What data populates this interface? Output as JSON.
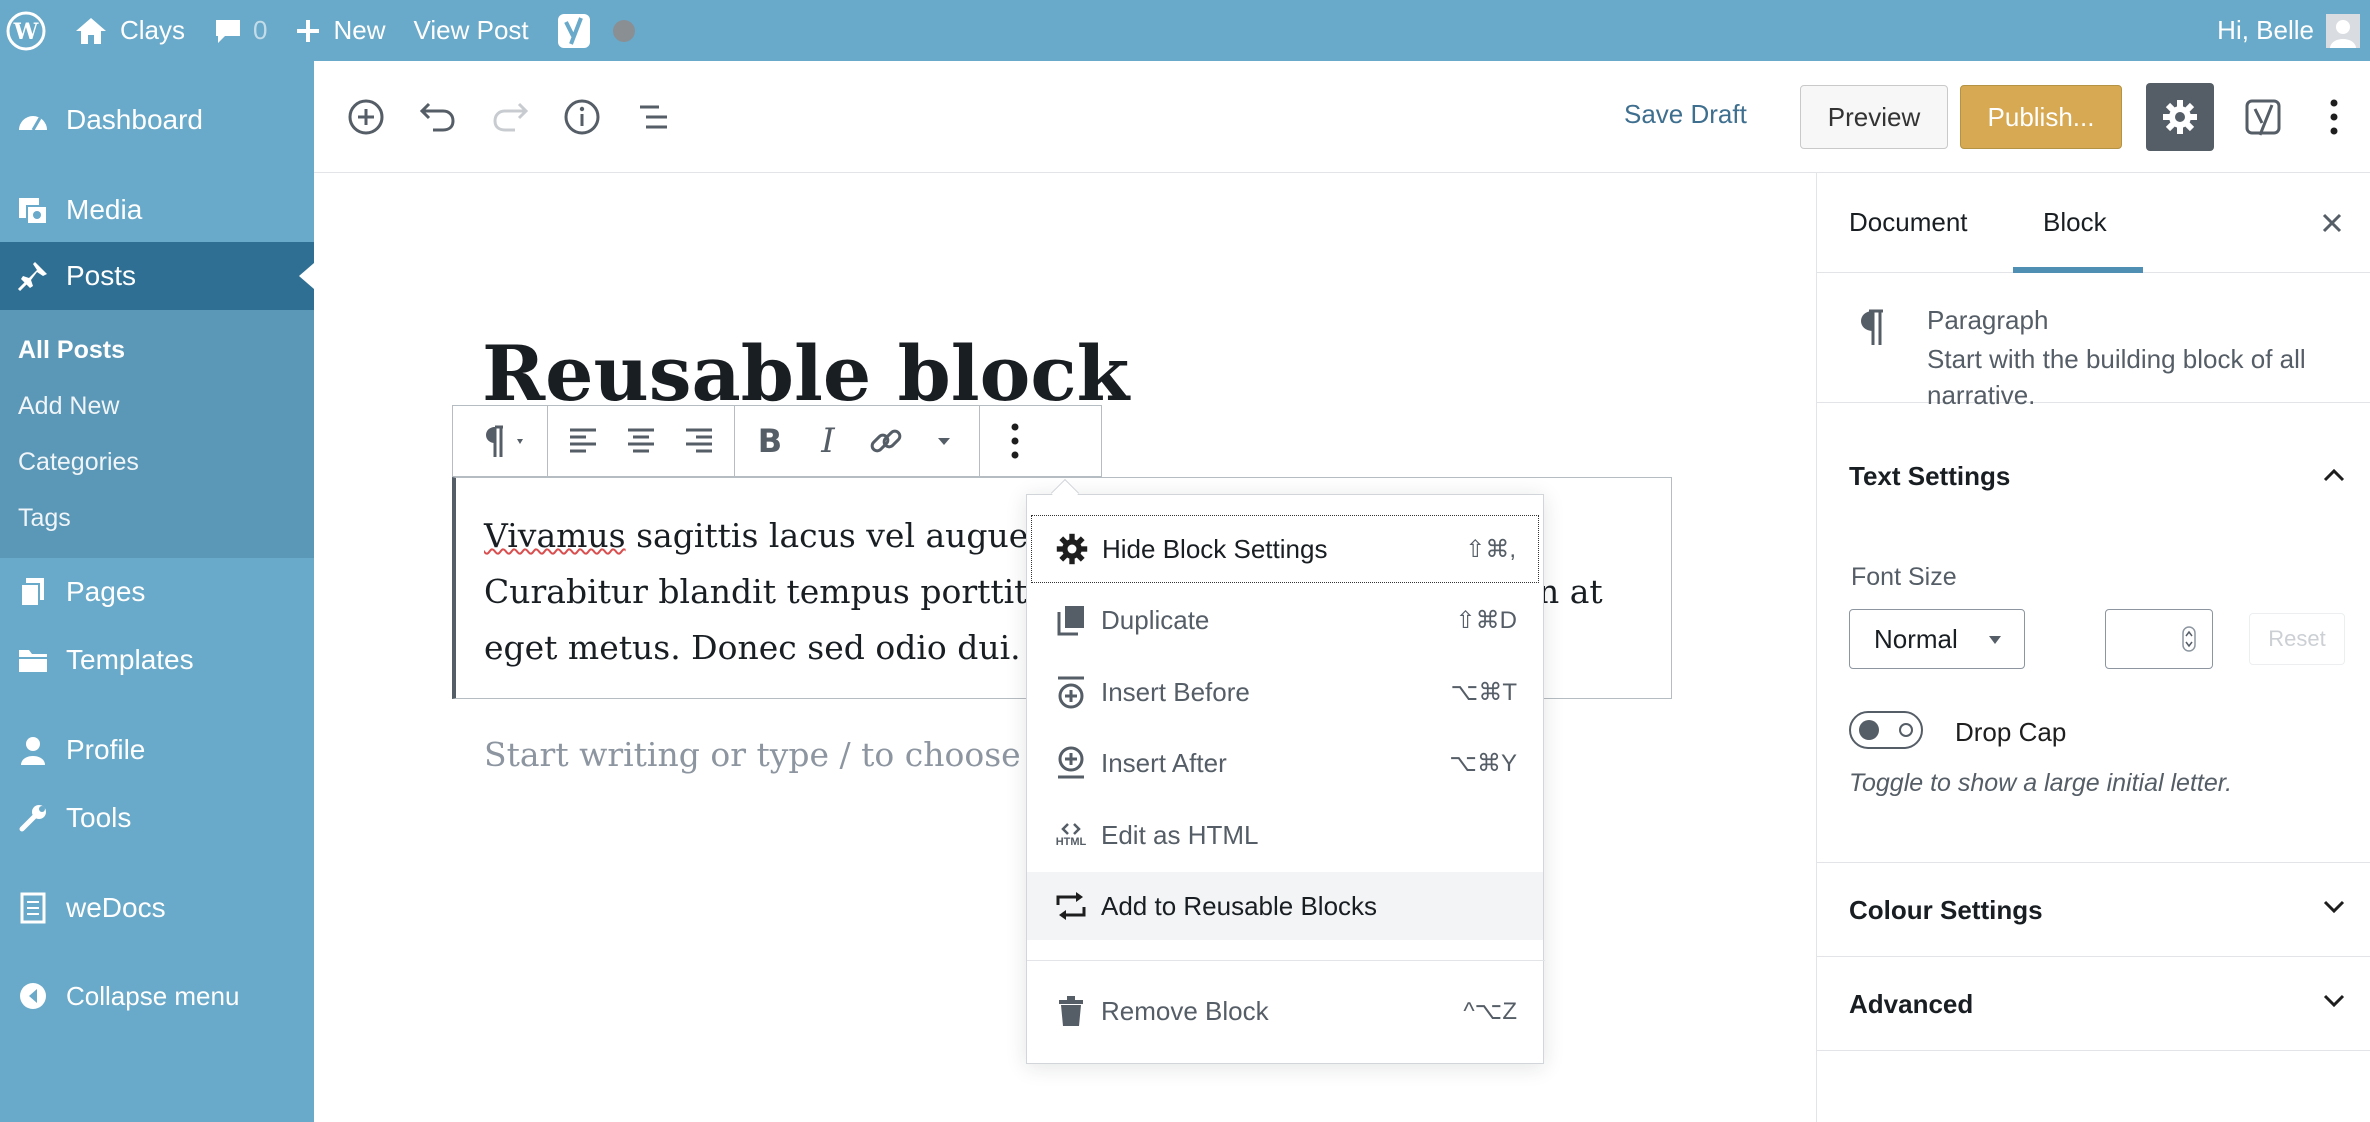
{
  "admin_bar": {
    "site_name": "Clays",
    "comments_count": "0",
    "new_label": "New",
    "view_post_label": "View Post",
    "greeting": "Hi, Belle"
  },
  "sidebar": {
    "items": [
      {
        "label": "Dashboard",
        "icon": "dashboard-icon"
      },
      {
        "label": "Media",
        "icon": "media-icon"
      },
      {
        "label": "Posts",
        "icon": "pin-icon"
      },
      {
        "label": "Pages",
        "icon": "pages-icon"
      },
      {
        "label": "Templates",
        "icon": "folder-icon"
      },
      {
        "label": "Profile",
        "icon": "user-icon"
      },
      {
        "label": "Tools",
        "icon": "wrench-icon"
      },
      {
        "label": "weDocs",
        "icon": "document-icon"
      }
    ],
    "submenu": [
      "All Posts",
      "Add New",
      "Categories",
      "Tags"
    ],
    "collapse_label": "Collapse menu"
  },
  "toolbar": {
    "save_draft": "Save Draft",
    "preview": "Preview",
    "publish": "Publish..."
  },
  "editor": {
    "title": "Reusable block",
    "paragraph_lines": [
      {
        "spell": "Vivamus",
        "rest": " sagittis lacus vel augue lao",
        "tail": "."
      },
      {
        "text": "Curabitur blandit tempus porttitor.",
        "tail": "n at"
      },
      {
        "text": "eget metus. Donec sed odio dui."
      }
    ],
    "placeholder": "Start writing or type / to choose a bl"
  },
  "block_menu": {
    "items": [
      {
        "label": "Hide Block Settings",
        "shortcut": "⇧⌘,",
        "icon": "gear-icon"
      },
      {
        "label": "Duplicate",
        "shortcut": "⇧⌘D",
        "icon": "duplicate-icon"
      },
      {
        "label": "Insert Before",
        "shortcut": "⌥⌘T",
        "icon": "insert-before-icon"
      },
      {
        "label": "Insert After",
        "shortcut": "⌥⌘Y",
        "icon": "insert-after-icon"
      },
      {
        "label": "Edit as HTML",
        "shortcut": "",
        "icon": "html-icon"
      },
      {
        "label": "Add to Reusable Blocks",
        "shortcut": "",
        "icon": "reusable-icon"
      },
      {
        "label": "Remove Block",
        "shortcut": "^⌥Z",
        "icon": "trash-icon"
      }
    ],
    "html_icon_text": "HTML"
  },
  "settings_panel": {
    "tabs": [
      "Document",
      "Block"
    ],
    "active_tab": "Block",
    "block_card": {
      "title": "Paragraph",
      "description_line1": "Start with the building block of all",
      "description_line2": "narrative."
    },
    "text_settings": {
      "title": "Text Settings",
      "font_size_label": "Font Size",
      "font_size_value": "Normal",
      "reset_label": "Reset",
      "drop_cap_label": "Drop Cap",
      "drop_cap_help": "Toggle to show a large initial letter.",
      "drop_cap_enabled": false
    },
    "colour_settings_title": "Colour Settings",
    "advanced_title": "Advanced"
  },
  "colors": {
    "admin_blue": "#69a9c9",
    "current_menu": "#2f6f93",
    "publish": "#d6a952",
    "tab_underline": "#4f8fb3"
  }
}
